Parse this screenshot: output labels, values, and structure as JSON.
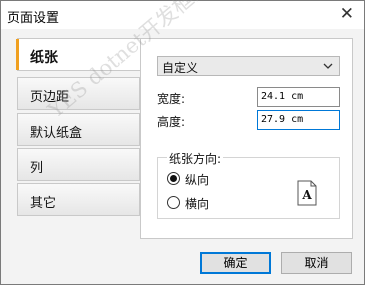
{
  "window": {
    "title": "页面设置",
    "close_glyph": "✕"
  },
  "tabs": [
    {
      "label": "纸张",
      "active": true
    },
    {
      "label": "页边距",
      "active": false
    },
    {
      "label": "默认纸盒",
      "active": false
    },
    {
      "label": "列",
      "active": false
    },
    {
      "label": "其它",
      "active": false
    }
  ],
  "paper": {
    "size_select": {
      "value": "自定义"
    },
    "width": {
      "label": "宽度:",
      "value": "24.1 cm"
    },
    "height": {
      "label": "高度:",
      "value": "27.9 cm"
    }
  },
  "orientation": {
    "group_label": "纸张方向:",
    "portrait": {
      "label": "纵向",
      "checked": true
    },
    "landscape": {
      "label": "横向",
      "checked": false
    },
    "preview_letter": "A"
  },
  "buttons": {
    "ok": "确定",
    "cancel": "取消"
  },
  "watermark": "YES dotnet开发框架 www.yesdotnet.net",
  "colors": {
    "tab_accent": "#f0a020",
    "focus_border": "#0078d7"
  },
  "icons": {
    "close": "close-icon",
    "dropdown": "chevron-down-icon",
    "page": "page-portrait-icon"
  }
}
